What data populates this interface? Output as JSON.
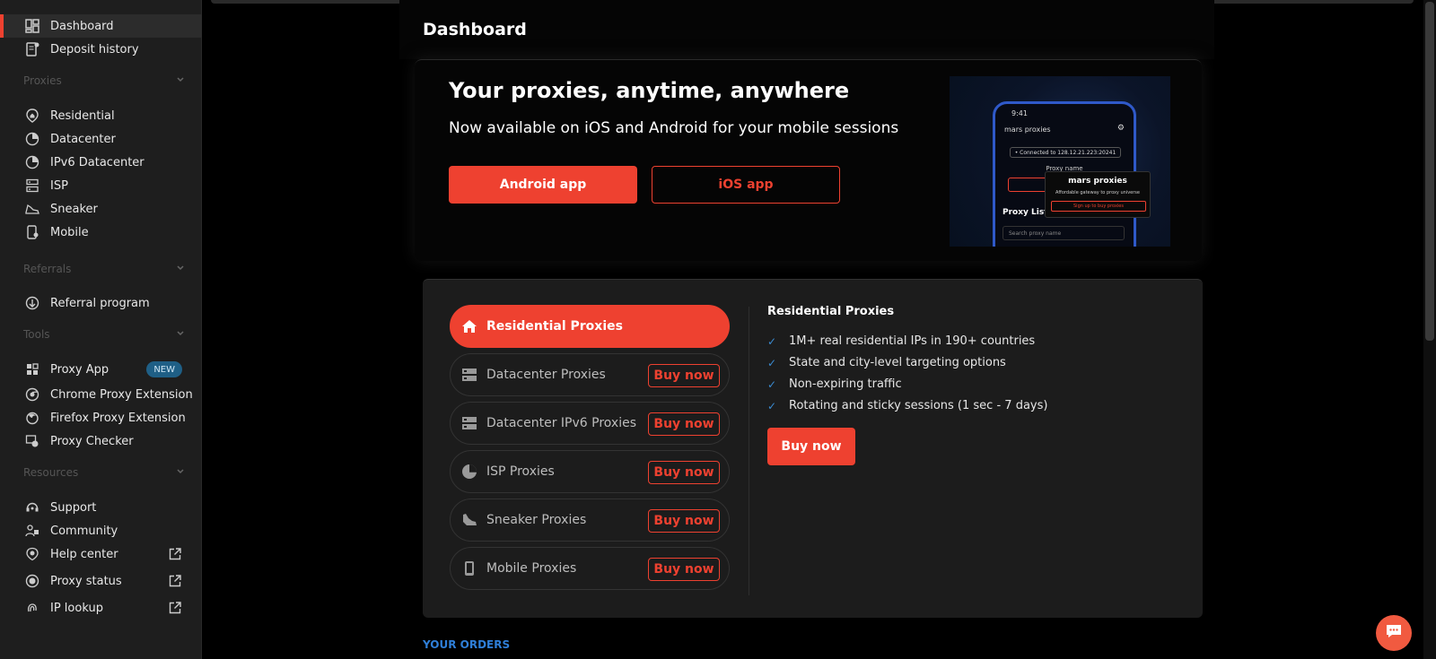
{
  "sidebar": {
    "top_items": [
      {
        "label": "Dashboard",
        "icon": "dashboard-icon",
        "active": true
      },
      {
        "label": "Deposit history",
        "icon": "receipt-icon"
      }
    ],
    "sections": [
      {
        "title": "Proxies",
        "items": [
          {
            "label": "Residential",
            "icon": "home-pin-icon"
          },
          {
            "label": "Datacenter",
            "icon": "pie-icon"
          },
          {
            "label": "IPv6 Datacenter",
            "icon": "pie-icon"
          },
          {
            "label": "ISP",
            "icon": "server-icon"
          },
          {
            "label": "Sneaker",
            "icon": "sneaker-icon"
          },
          {
            "label": "Mobile",
            "icon": "mobile-icon"
          }
        ]
      },
      {
        "title": "Referrals",
        "items": [
          {
            "label": "Referral program",
            "icon": "referral-icon"
          }
        ]
      },
      {
        "title": "Tools",
        "items": [
          {
            "label": "Proxy App",
            "icon": "grid-icon",
            "badge": "NEW"
          },
          {
            "label": "Chrome Proxy Extension",
            "icon": "chrome-icon"
          },
          {
            "label": "Firefox Proxy Extension",
            "icon": "firefox-icon"
          },
          {
            "label": "Proxy Checker",
            "icon": "checker-icon"
          }
        ]
      },
      {
        "title": "Resources",
        "items": [
          {
            "label": "Support",
            "icon": "headset-icon"
          },
          {
            "label": "Community",
            "icon": "community-icon"
          },
          {
            "label": "Help center",
            "icon": "help-icon",
            "external": true
          },
          {
            "label": "Proxy status",
            "icon": "status-icon",
            "external": true
          },
          {
            "label": "IP lookup",
            "icon": "fingerprint-icon",
            "external": true
          }
        ]
      }
    ]
  },
  "page": {
    "title": "Dashboard"
  },
  "banner": {
    "headline": "Your proxies, anytime, anywhere",
    "subheadline": "Now available on iOS and Android for your mobile sessions",
    "android_label": "Android app",
    "ios_label": "iOS app",
    "phone": {
      "time": "9:41",
      "brand": "mars proxies",
      "connected": "• Connected to 128.12.21.223:20241",
      "proxy_name": "Proxy name",
      "proxy_list": "Proxy List",
      "search_placeholder": "Search proxy name",
      "popup_brand": "mars proxies",
      "popup_tagline": "Affordable gateway to proxy universe",
      "popup_button": "Sign up to buy proxies"
    }
  },
  "products": {
    "items": [
      {
        "label": "Residential Proxies",
        "icon": "home-icon",
        "active": true
      },
      {
        "label": "Datacenter Proxies",
        "icon": "server-icon",
        "buy": "Buy now"
      },
      {
        "label": "Datacenter IPv6 Proxies",
        "icon": "server-icon",
        "buy": "Buy now"
      },
      {
        "label": "ISP Proxies",
        "icon": "pie-icon",
        "buy": "Buy now"
      },
      {
        "label": "Sneaker Proxies",
        "icon": "sneaker-icon",
        "buy": "Buy now"
      },
      {
        "label": "Mobile Proxies",
        "icon": "mobile-icon",
        "buy": "Buy now"
      }
    ],
    "detail": {
      "title": "Residential Proxies",
      "features": [
        "1M+ real residential IPs in 190+ countries",
        "State and city-level targeting options",
        "Non-expiring traffic",
        "Rotating and sticky sessions (1 sec - 7 days)"
      ],
      "buy_label": "Buy now"
    }
  },
  "orders": {
    "title": "YOUR ORDERS"
  },
  "colors": {
    "accent": "#ee4130",
    "link": "#2f7fd8",
    "badge": "#1f5f86"
  }
}
